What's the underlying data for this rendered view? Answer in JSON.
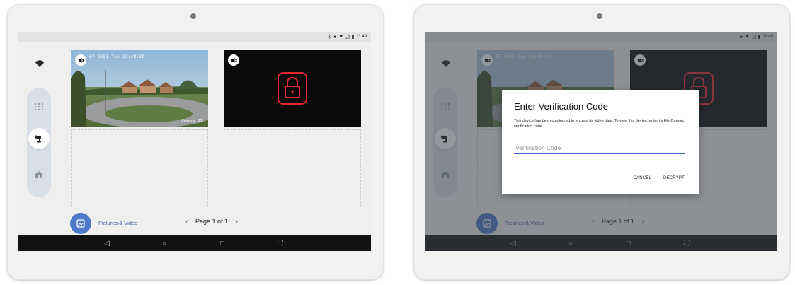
{
  "status_bar": {
    "time": "11:49",
    "icons": [
      "bluetooth-icon",
      "location-icon",
      "wifi-icon",
      "signal-icon",
      "battery-icon"
    ]
  },
  "camera_tile": {
    "timestamp": "07-2021 Tue 11:48:39",
    "camera_label": "Camera 01",
    "mute_icon": "muted-speaker-icon"
  },
  "locked_tile": {
    "mute_icon": "muted-speaker-icon",
    "lock_icon": "lock-icon",
    "lock_color": "#e3262b"
  },
  "sidebar": {
    "items": [
      "wifi-icon",
      "grid-icon",
      "camera-icon",
      "home-icon"
    ],
    "active": "camera-icon"
  },
  "footer": {
    "pictures_video_label": "Pictures & Video",
    "pager": {
      "prev": "‹",
      "label": "Page 1 of 1",
      "next": "›"
    }
  },
  "navbar": {
    "buttons": [
      "back-icon",
      "home-circle-icon",
      "recents-icon",
      "screenshot-icon"
    ]
  },
  "dialog": {
    "title": "Enter Verification Code",
    "body": "This device has been configured to encrypt its video data. To view this device, enter its Hik-Connect verification code.",
    "input_placeholder": "Verification Code",
    "input_value": "",
    "cancel_label": "CANCEL",
    "decrypt_label": "DECRYPT"
  },
  "colors": {
    "accent": "#4f79c9",
    "input_underline": "#3a63c4",
    "lock": "#e3262b",
    "navbar": "#121212"
  }
}
